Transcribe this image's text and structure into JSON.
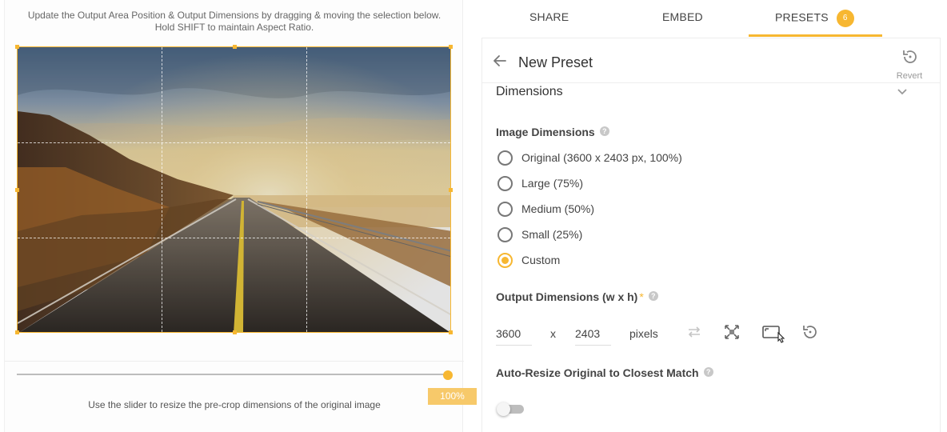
{
  "editor": {
    "instructions_line1": "Update the Output Area Position & Output Dimensions by dragging & moving the selection below.",
    "instructions_line2": "Hold SHIFT to maintain Aspect Ratio.",
    "slider_percent": "100%",
    "slider_value": 1.0,
    "slider_caption": "Use the slider to resize the pre-crop dimensions of the original image"
  },
  "tabs": [
    {
      "label": "SHARE"
    },
    {
      "label": "EMBED"
    },
    {
      "label": "PRESETS",
      "badge": "6",
      "active": true
    }
  ],
  "preset": {
    "title": "New Preset",
    "revert_label": "Revert",
    "section": "Dimensions",
    "image_dimensions_label": "Image Dimensions",
    "options": [
      {
        "label": "Original (3600 x 2403 px, 100%)",
        "selected": false
      },
      {
        "label": "Large (75%)",
        "selected": false
      },
      {
        "label": "Medium (50%)",
        "selected": false
      },
      {
        "label": "Small (25%)",
        "selected": false
      },
      {
        "label": "Custom",
        "selected": true
      }
    ],
    "output_label": "Output Dimensions (w x h)",
    "required_mark": "*",
    "width": "3600",
    "times": "x",
    "height": "2403",
    "unit": "pixels",
    "auto_resize_label": "Auto-Resize Original to Closest Match",
    "auto_resize_on": false,
    "help_mark": "?"
  },
  "colors": {
    "accent": "#f7b731",
    "badge_light": "#f7c96a"
  }
}
